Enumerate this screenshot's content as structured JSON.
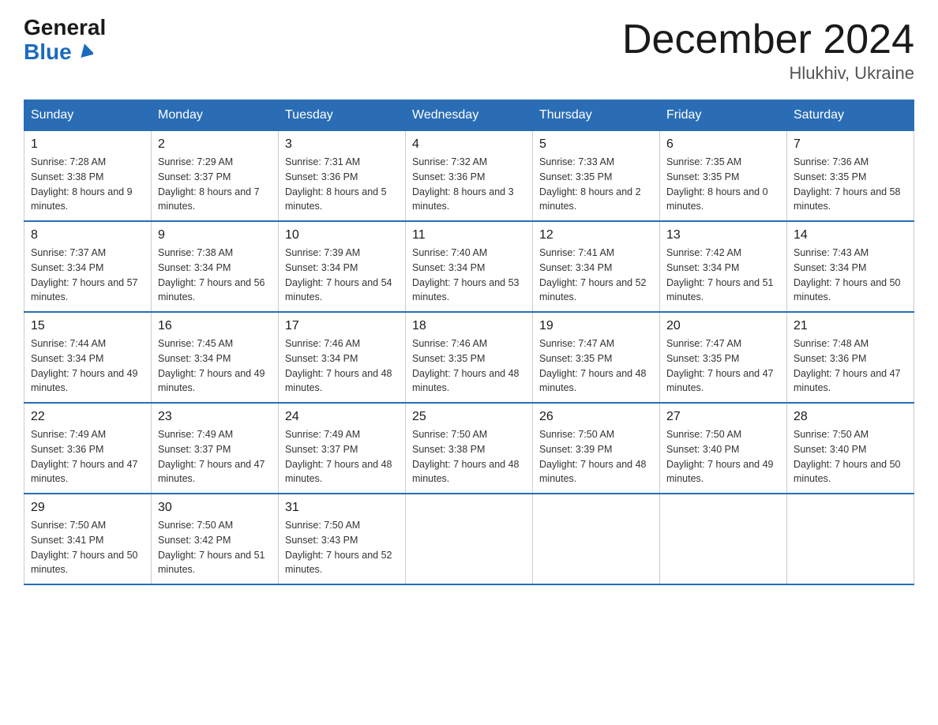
{
  "header": {
    "logo_top": "General",
    "logo_bottom": "Blue",
    "month_year": "December 2024",
    "location": "Hlukhiv, Ukraine"
  },
  "days_of_week": [
    "Sunday",
    "Monday",
    "Tuesday",
    "Wednesday",
    "Thursday",
    "Friday",
    "Saturday"
  ],
  "weeks": [
    [
      {
        "day": "1",
        "sunrise": "7:28 AM",
        "sunset": "3:38 PM",
        "daylight": "8 hours and 9 minutes."
      },
      {
        "day": "2",
        "sunrise": "7:29 AM",
        "sunset": "3:37 PM",
        "daylight": "8 hours and 7 minutes."
      },
      {
        "day": "3",
        "sunrise": "7:31 AM",
        "sunset": "3:36 PM",
        "daylight": "8 hours and 5 minutes."
      },
      {
        "day": "4",
        "sunrise": "7:32 AM",
        "sunset": "3:36 PM",
        "daylight": "8 hours and 3 minutes."
      },
      {
        "day": "5",
        "sunrise": "7:33 AM",
        "sunset": "3:35 PM",
        "daylight": "8 hours and 2 minutes."
      },
      {
        "day": "6",
        "sunrise": "7:35 AM",
        "sunset": "3:35 PM",
        "daylight": "8 hours and 0 minutes."
      },
      {
        "day": "7",
        "sunrise": "7:36 AM",
        "sunset": "3:35 PM",
        "daylight": "7 hours and 58 minutes."
      }
    ],
    [
      {
        "day": "8",
        "sunrise": "7:37 AM",
        "sunset": "3:34 PM",
        "daylight": "7 hours and 57 minutes."
      },
      {
        "day": "9",
        "sunrise": "7:38 AM",
        "sunset": "3:34 PM",
        "daylight": "7 hours and 56 minutes."
      },
      {
        "day": "10",
        "sunrise": "7:39 AM",
        "sunset": "3:34 PM",
        "daylight": "7 hours and 54 minutes."
      },
      {
        "day": "11",
        "sunrise": "7:40 AM",
        "sunset": "3:34 PM",
        "daylight": "7 hours and 53 minutes."
      },
      {
        "day": "12",
        "sunrise": "7:41 AM",
        "sunset": "3:34 PM",
        "daylight": "7 hours and 52 minutes."
      },
      {
        "day": "13",
        "sunrise": "7:42 AM",
        "sunset": "3:34 PM",
        "daylight": "7 hours and 51 minutes."
      },
      {
        "day": "14",
        "sunrise": "7:43 AM",
        "sunset": "3:34 PM",
        "daylight": "7 hours and 50 minutes."
      }
    ],
    [
      {
        "day": "15",
        "sunrise": "7:44 AM",
        "sunset": "3:34 PM",
        "daylight": "7 hours and 49 minutes."
      },
      {
        "day": "16",
        "sunrise": "7:45 AM",
        "sunset": "3:34 PM",
        "daylight": "7 hours and 49 minutes."
      },
      {
        "day": "17",
        "sunrise": "7:46 AM",
        "sunset": "3:34 PM",
        "daylight": "7 hours and 48 minutes."
      },
      {
        "day": "18",
        "sunrise": "7:46 AM",
        "sunset": "3:35 PM",
        "daylight": "7 hours and 48 minutes."
      },
      {
        "day": "19",
        "sunrise": "7:47 AM",
        "sunset": "3:35 PM",
        "daylight": "7 hours and 48 minutes."
      },
      {
        "day": "20",
        "sunrise": "7:47 AM",
        "sunset": "3:35 PM",
        "daylight": "7 hours and 47 minutes."
      },
      {
        "day": "21",
        "sunrise": "7:48 AM",
        "sunset": "3:36 PM",
        "daylight": "7 hours and 47 minutes."
      }
    ],
    [
      {
        "day": "22",
        "sunrise": "7:49 AM",
        "sunset": "3:36 PM",
        "daylight": "7 hours and 47 minutes."
      },
      {
        "day": "23",
        "sunrise": "7:49 AM",
        "sunset": "3:37 PM",
        "daylight": "7 hours and 47 minutes."
      },
      {
        "day": "24",
        "sunrise": "7:49 AM",
        "sunset": "3:37 PM",
        "daylight": "7 hours and 48 minutes."
      },
      {
        "day": "25",
        "sunrise": "7:50 AM",
        "sunset": "3:38 PM",
        "daylight": "7 hours and 48 minutes."
      },
      {
        "day": "26",
        "sunrise": "7:50 AM",
        "sunset": "3:39 PM",
        "daylight": "7 hours and 48 minutes."
      },
      {
        "day": "27",
        "sunrise": "7:50 AM",
        "sunset": "3:40 PM",
        "daylight": "7 hours and 49 minutes."
      },
      {
        "day": "28",
        "sunrise": "7:50 AM",
        "sunset": "3:40 PM",
        "daylight": "7 hours and 50 minutes."
      }
    ],
    [
      {
        "day": "29",
        "sunrise": "7:50 AM",
        "sunset": "3:41 PM",
        "daylight": "7 hours and 50 minutes."
      },
      {
        "day": "30",
        "sunrise": "7:50 AM",
        "sunset": "3:42 PM",
        "daylight": "7 hours and 51 minutes."
      },
      {
        "day": "31",
        "sunrise": "7:50 AM",
        "sunset": "3:43 PM",
        "daylight": "7 hours and 52 minutes."
      },
      null,
      null,
      null,
      null
    ]
  ]
}
